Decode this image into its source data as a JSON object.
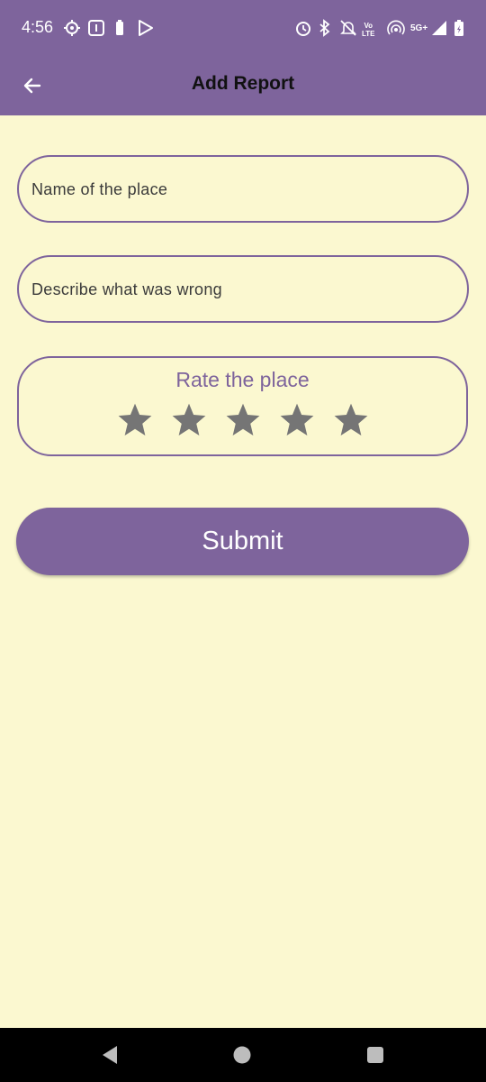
{
  "status_bar": {
    "time": "4:56",
    "network": "5G+",
    "volte_line1": "Vo",
    "volte_line2": "LTE",
    "left_icons": [
      "settings-icon",
      "notification-icon",
      "battery-small-icon",
      "play-store-icon"
    ],
    "right_icons": [
      "alarm-icon",
      "bluetooth-icon",
      "mute-icon",
      "volte-icon",
      "hotspot-icon",
      "signal-icon",
      "battery-icon"
    ]
  },
  "app_bar": {
    "title": "Add Report",
    "back_icon": "arrow-left-icon"
  },
  "form": {
    "place_name_placeholder": "Name of the place",
    "description_placeholder": "Describe what was wrong",
    "rating_label": "Rate the place",
    "rating_value": 0,
    "rating_max": 5,
    "submit_label": "Submit"
  },
  "colors": {
    "primary": "#7E649C",
    "background": "#FBF8D0",
    "star_inactive": "#757575",
    "nav_bar": "#000000"
  },
  "nav_bar": {
    "icons": [
      "back-triangle-icon",
      "home-circle-icon",
      "recents-square-icon"
    ]
  }
}
